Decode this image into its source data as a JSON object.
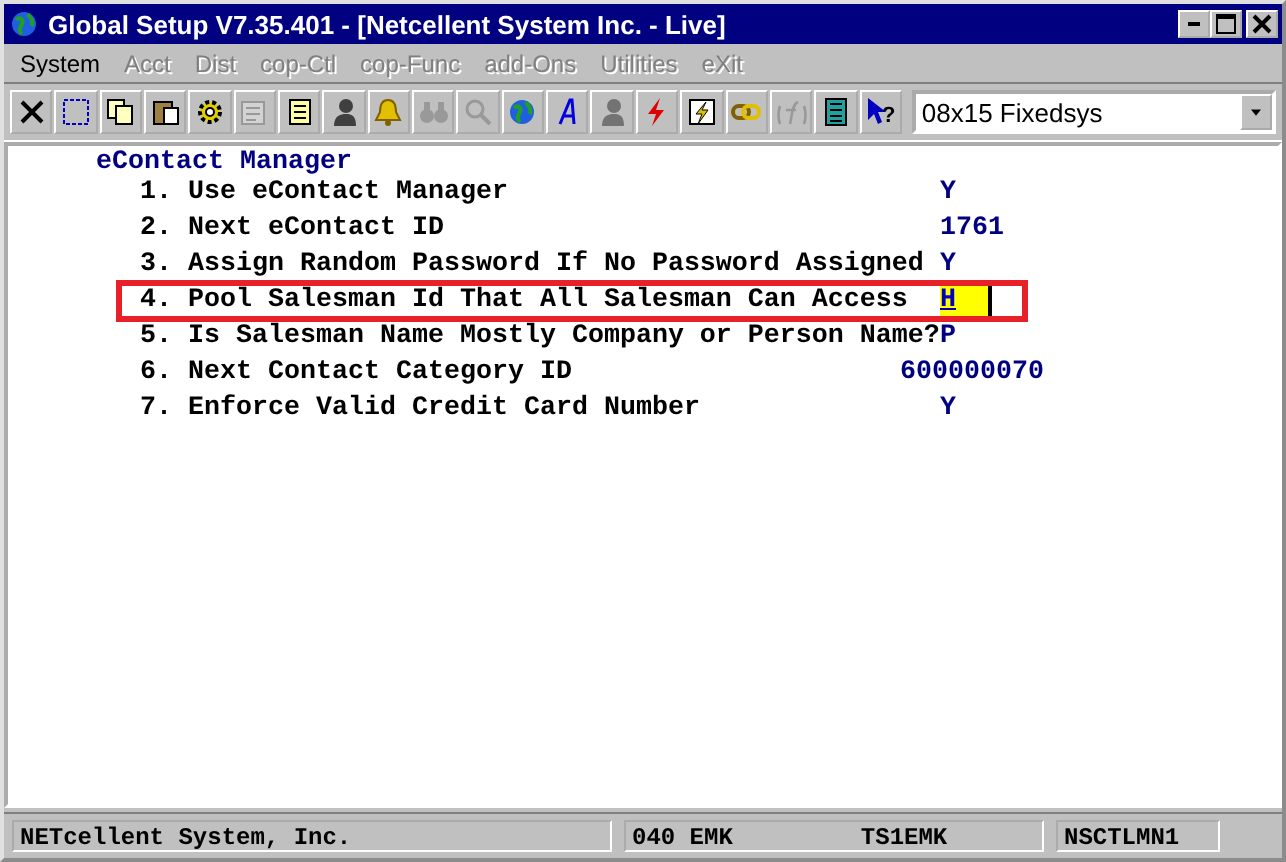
{
  "window": {
    "title": "Global Setup V7.35.401 - [Netcellent System Inc. - Live]"
  },
  "menu": [
    {
      "label": "System",
      "disabled": false
    },
    {
      "label": "Acct",
      "disabled": true
    },
    {
      "label": "Dist",
      "disabled": true
    },
    {
      "label": "cop-Ctl",
      "disabled": true
    },
    {
      "label": "cop-Func",
      "disabled": true
    },
    {
      "label": "add-Ons",
      "disabled": true
    },
    {
      "label": "Utilities",
      "disabled": true
    },
    {
      "label": "eXit",
      "disabled": true
    }
  ],
  "toolbar": {
    "tools": [
      {
        "kind": "close",
        "disabled": false
      },
      {
        "kind": "select",
        "disabled": false
      },
      {
        "kind": "copy",
        "disabled": false
      },
      {
        "kind": "paste",
        "disabled": false
      },
      {
        "kind": "gear",
        "disabled": false
      },
      {
        "kind": "properties",
        "disabled": true
      },
      {
        "kind": "list",
        "disabled": false
      },
      {
        "kind": "user",
        "disabled": false
      },
      {
        "kind": "bell",
        "disabled": false
      },
      {
        "kind": "binoculars",
        "disabled": true
      },
      {
        "kind": "magnifier",
        "disabled": true
      },
      {
        "kind": "globe",
        "disabled": false
      },
      {
        "kind": "font",
        "disabled": false
      },
      {
        "kind": "user",
        "disabled": true
      },
      {
        "kind": "lightning",
        "disabled": false
      },
      {
        "kind": "lightning-page",
        "disabled": false
      },
      {
        "kind": "link",
        "disabled": false
      },
      {
        "kind": "function",
        "disabled": true
      },
      {
        "kind": "document",
        "disabled": false
      },
      {
        "kind": "help",
        "disabled": false,
        "label": "?"
      }
    ],
    "font_select": {
      "value": "08x15 Fixedsys"
    }
  },
  "screen": {
    "heading": "eContact Manager",
    "items": [
      {
        "label": "1. Use eContact Manager",
        "value": "Y",
        "selected": false
      },
      {
        "label": "2. Next eContact ID",
        "value": "1761",
        "selected": false
      },
      {
        "label": "3. Assign Random Password If No Password Assigned",
        "value": "Y",
        "selected": false
      },
      {
        "label": "4. Pool Salesman Id That All Salesman Can Access",
        "value": "H",
        "selected": true
      },
      {
        "label": "5. Is Salesman Name Mostly Company or Person Name?",
        "value": "P",
        "selected": false
      },
      {
        "label": "6. Next Contact Category ID",
        "value": "600000070",
        "selected": false
      },
      {
        "label": "7. Enforce Valid Credit Card Number",
        "value": "Y",
        "selected": false
      }
    ]
  },
  "status_bar": {
    "company": "NETcellent System, Inc.",
    "terminal": "040 EMK",
    "user": "TS1EMK",
    "program": "NSCTLMN1"
  }
}
